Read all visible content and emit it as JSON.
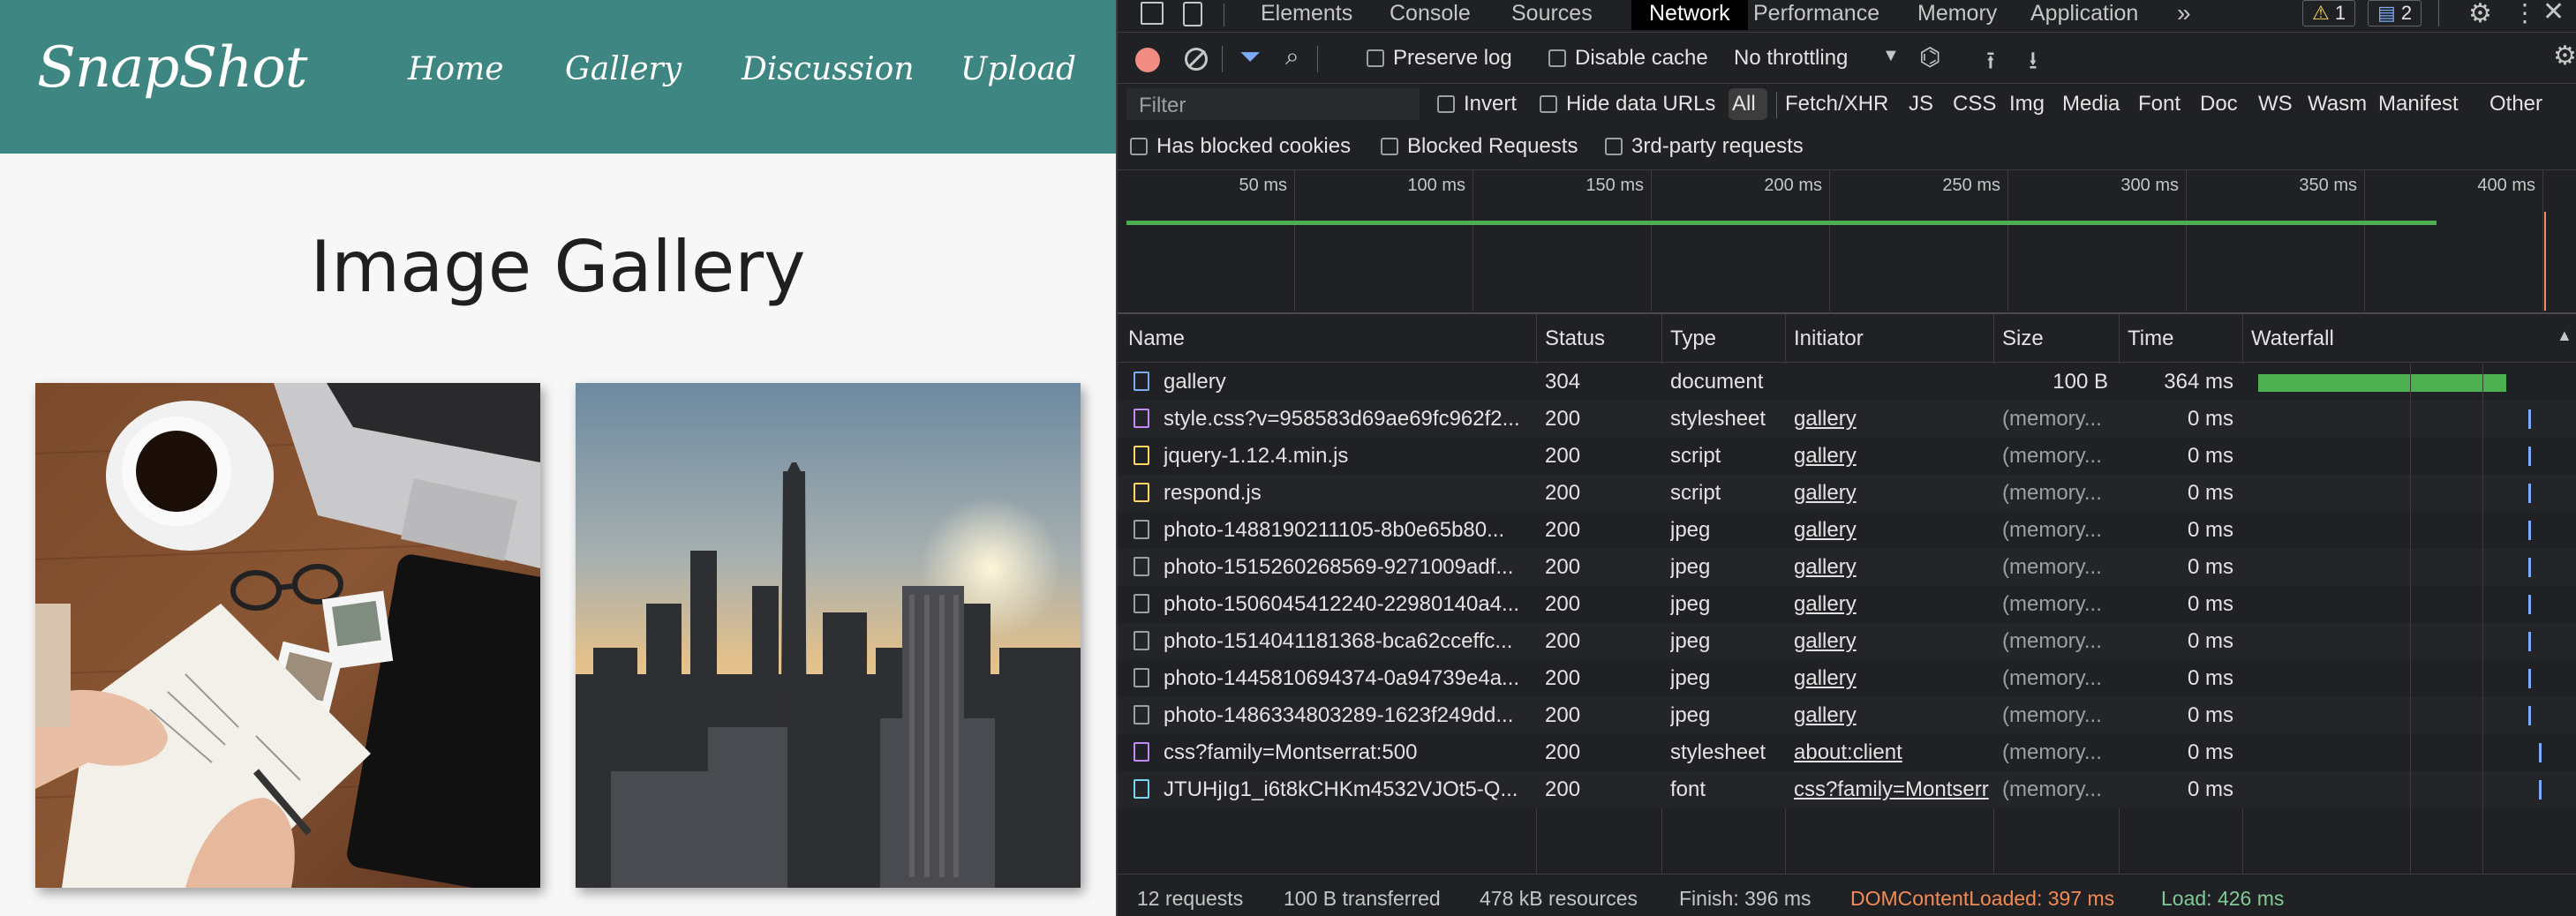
{
  "site": {
    "logo": "SnapShot",
    "nav": [
      "Home",
      "Gallery",
      "Discussion",
      "Upload"
    ],
    "title": "Image Gallery",
    "brand_color": "#3e8681"
  },
  "devtools": {
    "tabs": [
      "Elements",
      "Console",
      "Sources",
      "Network",
      "Performance",
      "Memory",
      "Application"
    ],
    "more_tabs": "»",
    "warnings": "1",
    "messages": "2",
    "toolbar": {
      "preserve_log": "Preserve log",
      "disable_cache": "Disable cache",
      "throttling": "No throttling"
    },
    "filter": {
      "placeholder": "Filter",
      "invert": "Invert",
      "hide_data_urls": "Hide data URLs",
      "types": [
        "All",
        "Fetch/XHR",
        "JS",
        "CSS",
        "Img",
        "Media",
        "Font",
        "Doc",
        "WS",
        "Wasm",
        "Manifest",
        "Other"
      ]
    },
    "options": {
      "blocked_cookies": "Has blocked cookies",
      "blocked_requests": "Blocked Requests",
      "third_party": "3rd-party requests"
    },
    "timeline_ticks": [
      "50 ms",
      "100 ms",
      "150 ms",
      "200 ms",
      "250 ms",
      "300 ms",
      "350 ms",
      "400 ms"
    ],
    "columns": [
      "Name",
      "Status",
      "Type",
      "Initiator",
      "Size",
      "Time",
      "Waterfall"
    ],
    "requests": [
      {
        "name": "gallery",
        "status": "304",
        "type": "document",
        "initiator": "",
        "size": "100 B",
        "time": "364 ms",
        "icon": "document-icon"
      },
      {
        "name": "style.css?v=958583d69ae69fc962f2...",
        "status": "200",
        "type": "stylesheet",
        "initiator": "gallery",
        "size": "(memory...",
        "time": "0 ms",
        "icon": "stylesheet-icon"
      },
      {
        "name": "jquery-1.12.4.min.js",
        "status": "200",
        "type": "script",
        "initiator": "gallery",
        "size": "(memory...",
        "time": "0 ms",
        "icon": "script-icon"
      },
      {
        "name": "respond.js",
        "status": "200",
        "type": "script",
        "initiator": "gallery",
        "size": "(memory...",
        "time": "0 ms",
        "icon": "script-icon"
      },
      {
        "name": "photo-1488190211105-8b0e65b80...",
        "status": "200",
        "type": "jpeg",
        "initiator": "gallery",
        "size": "(memory...",
        "time": "0 ms",
        "icon": "image-icon"
      },
      {
        "name": "photo-1515260268569-9271009adf...",
        "status": "200",
        "type": "jpeg",
        "initiator": "gallery",
        "size": "(memory...",
        "time": "0 ms",
        "icon": "image-icon"
      },
      {
        "name": "photo-1506045412240-22980140a4...",
        "status": "200",
        "type": "jpeg",
        "initiator": "gallery",
        "size": "(memory...",
        "time": "0 ms",
        "icon": "image-icon"
      },
      {
        "name": "photo-1514041181368-bca62cceffc...",
        "status": "200",
        "type": "jpeg",
        "initiator": "gallery",
        "size": "(memory...",
        "time": "0 ms",
        "icon": "image-icon"
      },
      {
        "name": "photo-1445810694374-0a94739e4a...",
        "status": "200",
        "type": "jpeg",
        "initiator": "gallery",
        "size": "(memory...",
        "time": "0 ms",
        "icon": "image-icon"
      },
      {
        "name": "photo-1486334803289-1623f249dd...",
        "status": "200",
        "type": "jpeg",
        "initiator": "gallery",
        "size": "(memory...",
        "time": "0 ms",
        "icon": "image-icon"
      },
      {
        "name": "css?family=Montserrat:500",
        "status": "200",
        "type": "stylesheet",
        "initiator": "about:client",
        "size": "(memory...",
        "time": "0 ms",
        "icon": "stylesheet-icon"
      },
      {
        "name": "JTUHjIg1_i6t8kCHKm4532VJOt5-Q...",
        "status": "200",
        "type": "font",
        "initiator": "css?family=Montserr",
        "size": "(memory...",
        "time": "0 ms",
        "icon": "font-icon"
      }
    ],
    "footer": {
      "requests": "12 requests",
      "transferred": "100 B transferred",
      "resources": "478 kB resources",
      "finish": "Finish: 396 ms",
      "dom_loaded": "DOMContentLoaded: 397 ms",
      "load": "Load: 426 ms"
    },
    "colors": {
      "dom_loaded": "#f28b54",
      "load": "#81c995",
      "waterfall_bar": "#4caf50",
      "recording": "#f28b82"
    }
  }
}
